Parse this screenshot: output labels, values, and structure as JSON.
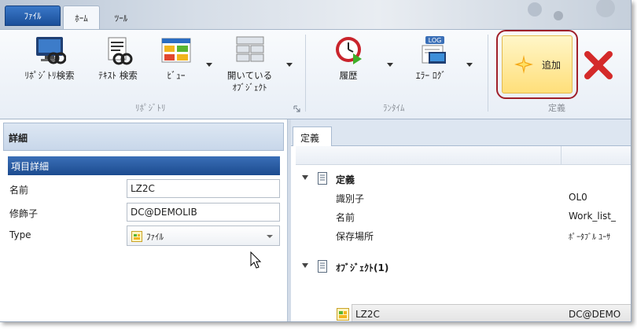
{
  "tabs": {
    "file": "ﾌｧｲﾙ",
    "home": "ﾎｰﾑ",
    "tools": "ﾂｰﾙ"
  },
  "ribbon": {
    "repository_search": "ﾘﾎﾟｼﾞﾄﾘ検索",
    "text_search": "ﾃｷｽﾄ 検索",
    "view": "ﾋﾞｭｰ",
    "open_objects_line1": "開いている",
    "open_objects_line2": "ｵﾌﾞｼﾞｪｸﾄ",
    "history": "履歴",
    "error_log": "ｴﾗｰ ﾛｸﾞ",
    "add": "追加",
    "group_repository": "ﾘﾎﾟｼﾞﾄﾘ",
    "group_runtime": "ﾗﾝﾀｲﾑ",
    "group_definition": "定義",
    "log_badge": "LOG"
  },
  "left_panel": {
    "header": "詳細",
    "section": "項目詳細",
    "fields": [
      {
        "label": "名前",
        "value": "LZ2C"
      },
      {
        "label": "修飾子",
        "value": "DC@DEMOLIB"
      },
      {
        "label": "Type",
        "value": "ﾌｧｲﾙ"
      }
    ]
  },
  "right_panel": {
    "tab": "定義",
    "tree": {
      "definition_node": "定義",
      "rows": [
        {
          "label": "識別子",
          "value": "OL0"
        },
        {
          "label": "名前",
          "value": "Work_list_"
        },
        {
          "label": "保存場所",
          "value": "ﾎﾟｰﾀﾌﾞﾙ ﾕｰｻ"
        }
      ],
      "objects_node": "ｵﾌﾞｼﾞｪｸﾄ(1)",
      "object_row": {
        "label": "LZ2C",
        "value": "DC@DEMO"
      }
    }
  },
  "colors": {
    "file_tab": "#2a63b0",
    "section_bar": "#2a5ba3",
    "add_highlight": "#ffe48a",
    "add_border": "#a0202a",
    "delete_x": "#d42a2a"
  }
}
